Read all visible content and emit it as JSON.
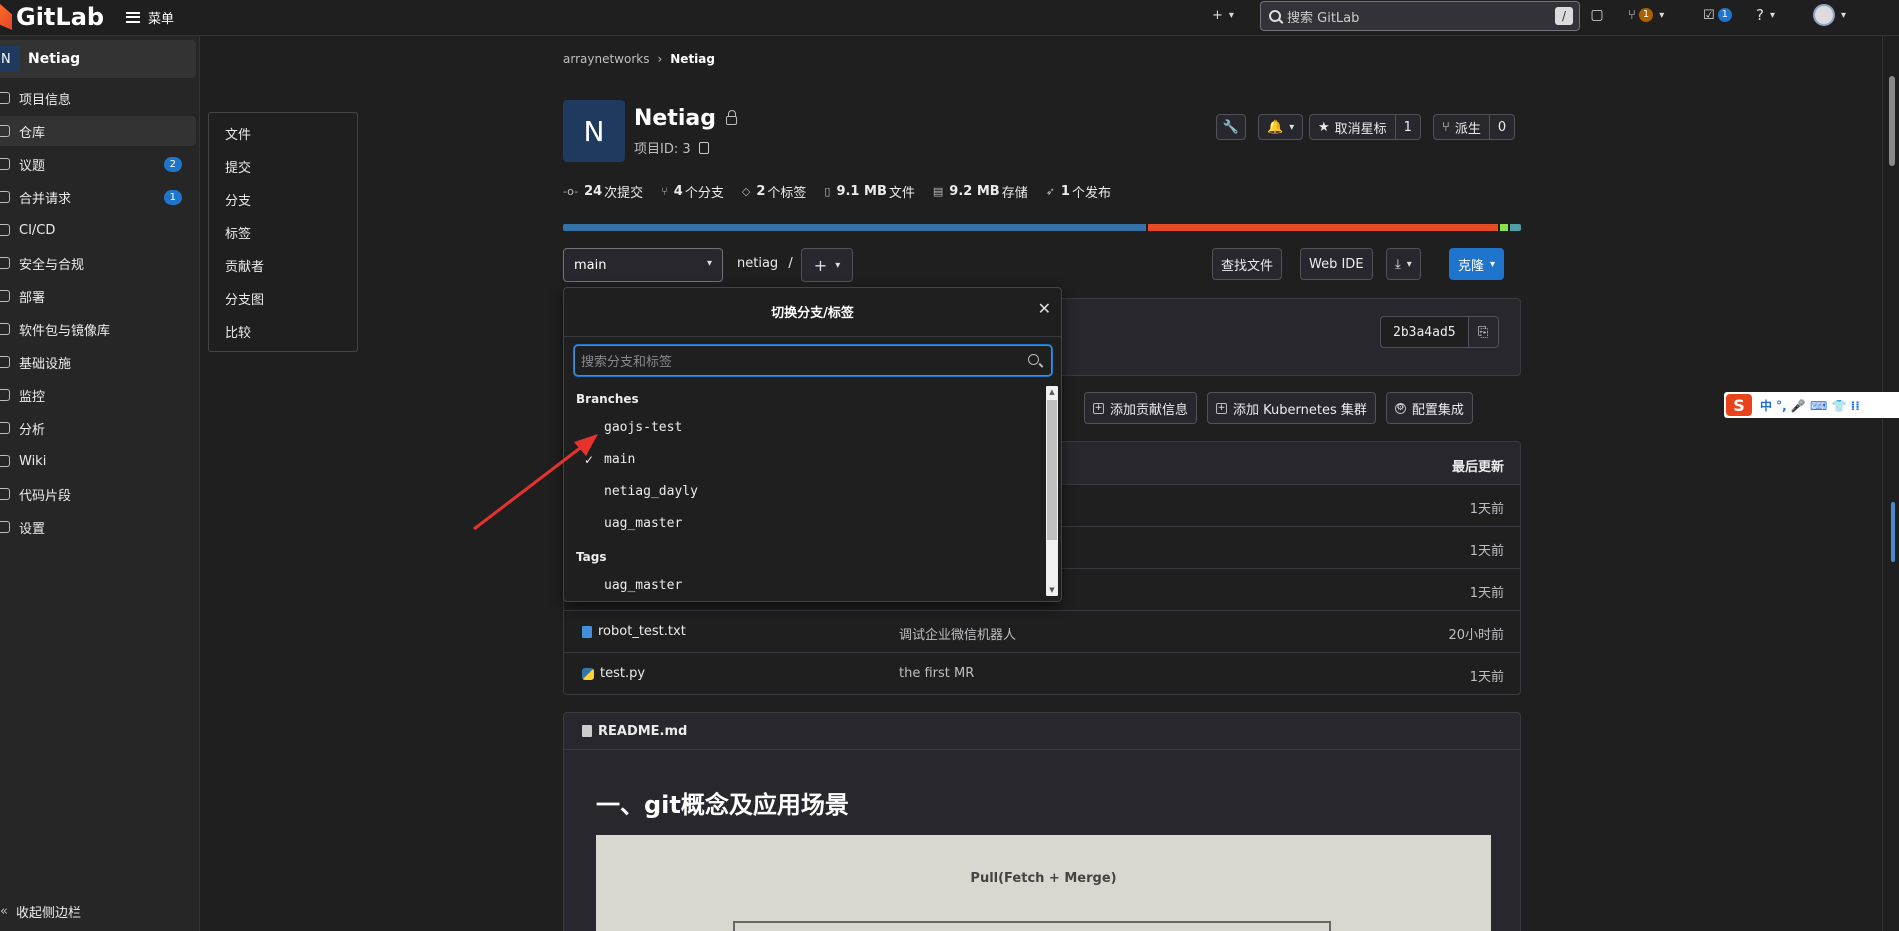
{
  "topbar": {
    "logo_text": "GitLab",
    "menu_label": "菜单",
    "search_placeholder": "搜索 GitLab",
    "search_shortcut": "/",
    "mr_count": "1",
    "todo_count": "1"
  },
  "sidebar": {
    "project_initial": "N",
    "project_name": "Netiag",
    "items": [
      {
        "label": "项目信息",
        "count": ""
      },
      {
        "label": "仓库",
        "count": ""
      },
      {
        "label": "议题",
        "count": "2"
      },
      {
        "label": "合并请求",
        "count": "1"
      },
      {
        "label": "CI/CD",
        "count": ""
      },
      {
        "label": "安全与合规",
        "count": ""
      },
      {
        "label": "部署",
        "count": ""
      },
      {
        "label": "软件包与镜像库",
        "count": ""
      },
      {
        "label": "基础设施",
        "count": ""
      },
      {
        "label": "监控",
        "count": ""
      },
      {
        "label": "分析",
        "count": ""
      },
      {
        "label": "Wiki",
        "count": ""
      },
      {
        "label": "代码片段",
        "count": ""
      },
      {
        "label": "设置",
        "count": ""
      }
    ],
    "collapse_label": "收起侧边栏"
  },
  "flyout": {
    "items": [
      "文件",
      "提交",
      "分支",
      "标签",
      "贡献者",
      "分支图",
      "比较"
    ]
  },
  "breadcrumb": {
    "parent": "arraynetworks",
    "sep": "›",
    "current": "Netiag"
  },
  "project": {
    "initial": "N",
    "title": "Netiag",
    "id_label": "项目ID: 3",
    "unstar_label": "取消星标",
    "star_count": "1",
    "fork_label": "派生",
    "fork_count": "0"
  },
  "stats": [
    {
      "value": "24",
      "label": "次提交",
      "icon": "commit-icon"
    },
    {
      "value": "4",
      "label": "个分支",
      "icon": "branch-icon"
    },
    {
      "value": "2",
      "label": "个标签",
      "icon": "tag-icon"
    },
    {
      "value": "9.1 MB",
      "label": "文件",
      "icon": "file-icon"
    },
    {
      "value": "9.2 MB",
      "label": "存储",
      "icon": "storage-icon"
    },
    {
      "value": "1",
      "label": "个发布",
      "icon": "rocket-icon"
    }
  ],
  "language_bar": [
    {
      "color": "#3572a5",
      "fraction": 0.612
    },
    {
      "color": "#e34c26",
      "fraction": 0.368
    },
    {
      "color": "#89e051",
      "fraction": 0.008
    },
    {
      "color": "#4f9da6",
      "fraction": 0.012
    }
  ],
  "repo_nav": {
    "branch": "main",
    "path": "netiag",
    "path_sep": "/",
    "find_file": "查找文件",
    "web_ide": "Web IDE",
    "clone": "克隆"
  },
  "commit": {
    "sha": "2b3a4ad5"
  },
  "quick_actions": [
    "添加贡献信息",
    "添加 Kubernetes 集群",
    "配置集成"
  ],
  "file_table": {
    "last_update_header": "最后更新",
    "rows": [
      {
        "name": "",
        "message": "",
        "time": "1天前",
        "type": "hidden"
      },
      {
        "name": "",
        "message": "",
        "time": "1天前",
        "type": "hidden"
      },
      {
        "name": "",
        "message": "",
        "time": "1天前",
        "type": "hidden"
      },
      {
        "name": "robot_test.txt",
        "message": "调试企业微信机器人",
        "time": "20小时前",
        "type": "file"
      },
      {
        "name": "test.py",
        "message": "the first MR",
        "time": "1天前",
        "type": "python"
      }
    ]
  },
  "readme": {
    "filename": "README.md",
    "heading": "一、git概念及应用场景",
    "image_caption": "Pull(Fetch + Merge)"
  },
  "dropdown": {
    "title": "切换分支/标签",
    "search_placeholder": "搜索分支和标签",
    "branches_header": "Branches",
    "branches": [
      {
        "name": "gaojs-test",
        "checked": false
      },
      {
        "name": "main",
        "checked": true
      },
      {
        "name": "netiag_dayly",
        "checked": false
      },
      {
        "name": "uag_master",
        "checked": false
      }
    ],
    "tags_header": "Tags",
    "tags": [
      {
        "name": "uag_master",
        "checked": false
      }
    ],
    "check_glyph": "✓"
  },
  "ime": {
    "logo": "S",
    "glyphs": "中 °, 🎤 ⌨ 👕 ⁞⁞"
  }
}
